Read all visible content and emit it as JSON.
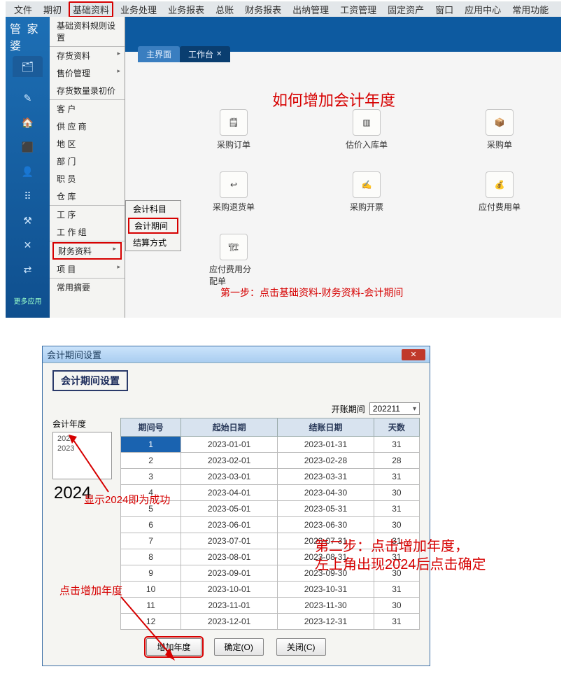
{
  "menubar": [
    "文件",
    "期初",
    "基础资料",
    "业务处理",
    "业务报表",
    "总账",
    "财务报表",
    "出纳管理",
    "工资管理",
    "固定资产",
    "窗口",
    "应用中心",
    "常用功能"
  ],
  "brand": "管 家 婆",
  "dropdown": {
    "items": [
      {
        "label": "基础资料规则设置",
        "sep": true
      },
      {
        "label": "存货资料",
        "sub": true
      },
      {
        "label": "售价管理",
        "sub": true
      },
      {
        "label": "存货数量录初价",
        "sep": true
      },
      {
        "label": "客  户"
      },
      {
        "label": "供 应 商"
      },
      {
        "label": "地  区"
      },
      {
        "label": "部  门"
      },
      {
        "label": "职  员"
      },
      {
        "label": "仓  库",
        "sep": true
      },
      {
        "label": "工  序"
      },
      {
        "label": "工 作 组",
        "sep": true
      },
      {
        "label": "财务资料",
        "sub": true,
        "hot": true
      },
      {
        "label": "项  目",
        "sub": true,
        "sep": true
      },
      {
        "label": "常用摘要"
      }
    ],
    "submenu": [
      {
        "label": "会计科目"
      },
      {
        "label": "会计期间",
        "hot": true
      },
      {
        "label": "结算方式"
      }
    ]
  },
  "tabs": [
    {
      "label": "主界面",
      "active": true
    },
    {
      "label": "工作台"
    }
  ],
  "headline": "如何增加会计年度",
  "icons": {
    "row1": [
      {
        "label": "采购订单"
      },
      {
        "label": "估价入库单"
      },
      {
        "label": "采购单"
      }
    ],
    "row2": [
      {
        "label": "采购退货单"
      },
      {
        "label": "采购开票"
      },
      {
        "label": "应付费用单"
      }
    ],
    "row3": [
      {
        "label": "应付费用分配单"
      }
    ]
  },
  "step1": "第一步：点击基础资料-财务资料-会计期间",
  "dialog": {
    "title": "会计期间设置",
    "badge": "会计期间设置",
    "open_label": "开账期间",
    "open_value": "202211",
    "year_label": "会计年度",
    "years": [
      "2022",
      "2023"
    ],
    "year_new": "2024",
    "headers": [
      "期间号",
      "起始日期",
      "结账日期",
      "天数"
    ],
    "rows": [
      [
        "1",
        "2023-01-01",
        "2023-01-31",
        "31"
      ],
      [
        "2",
        "2023-02-01",
        "2023-02-28",
        "28"
      ],
      [
        "3",
        "2023-03-01",
        "2023-03-31",
        "31"
      ],
      [
        "4",
        "2023-04-01",
        "2023-04-30",
        "30"
      ],
      [
        "5",
        "2023-05-01",
        "2023-05-31",
        "31"
      ],
      [
        "6",
        "2023-06-01",
        "2023-06-30",
        "30"
      ],
      [
        "7",
        "2023-07-01",
        "2023-07-31",
        "31"
      ],
      [
        "8",
        "2023-08-01",
        "2023-08-31",
        "31"
      ],
      [
        "9",
        "2023-09-01",
        "2023-09-30",
        "30"
      ],
      [
        "10",
        "2023-10-01",
        "2023-10-31",
        "31"
      ],
      [
        "11",
        "2023-11-01",
        "2023-11-30",
        "30"
      ],
      [
        "12",
        "2023-12-01",
        "2023-12-31",
        "31"
      ]
    ],
    "buttons": {
      "add": "增加年度",
      "ok": "确定(O)",
      "close": "关闭(C)"
    }
  },
  "anno": {
    "show": "显示2024即为成功",
    "click": "点击增加年度",
    "step2a": "第二步：点击增加年度，",
    "step2b": "左上角出现2024后点击确定"
  },
  "sidebar_more": "更多应用"
}
